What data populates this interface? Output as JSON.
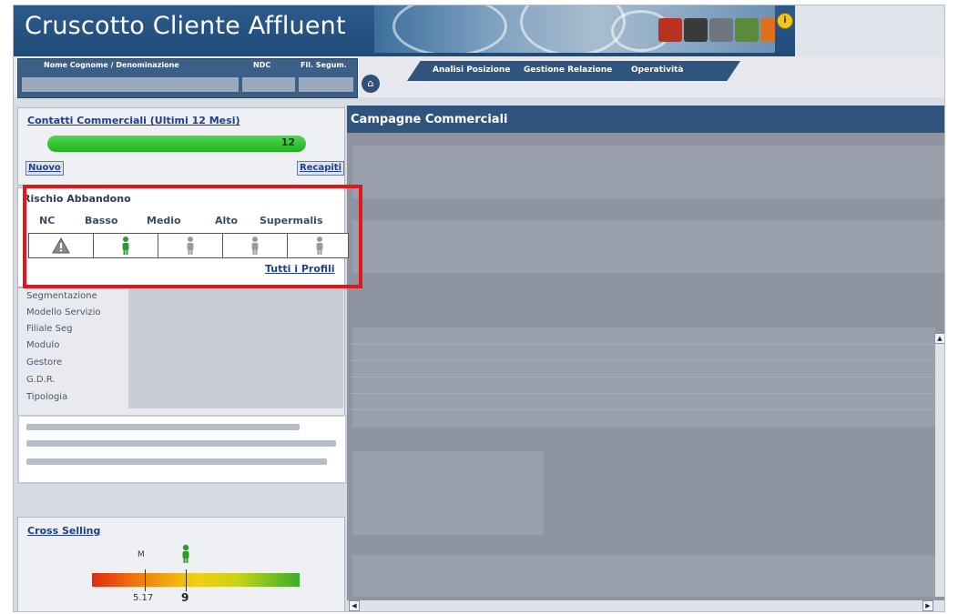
{
  "header": {
    "title": "Cruscotto Cliente Affluent"
  },
  "client_table": {
    "col_name": "Nome Cognome / Denominazione",
    "col_ndc": "NDC",
    "col_fil": "Fil. Segum."
  },
  "nav": {
    "tabs": [
      "Analisi Posizione",
      "Gestione Relazione",
      "Operatività"
    ]
  },
  "contatti": {
    "title": "Contatti Commerciali (Ultimi 12 Mesi)",
    "count_label": "12",
    "count": 12,
    "bar_fill": 1.0,
    "btn_nuovo": "Nuovo",
    "btn_recapiti": "Recapiti"
  },
  "rischio": {
    "title": "Rischio Abbandono",
    "levels": [
      "NC",
      "Basso",
      "Medio",
      "Alto",
      "Supermalis"
    ],
    "active_level": "Basso",
    "link": "Tutti i Profili"
  },
  "info": {
    "labels": [
      "Segmentazione",
      "Modello Servizio",
      "Filiale Seg",
      "Modulo",
      "Gestore",
      "G.D.R.",
      "Tipologia"
    ]
  },
  "cross_selling": {
    "title": "Cross Selling",
    "marker_label": "M",
    "scale_label": "5.17",
    "value_label": "9",
    "max_value": 12
  },
  "right": {
    "title": "Campagne Commerciali"
  },
  "colors": {
    "header_blue": "#2f557f",
    "progress_green": "#22b022",
    "highlight_red": "#e8141b"
  }
}
